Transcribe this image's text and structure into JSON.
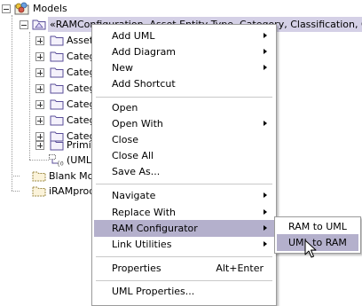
{
  "tree": {
    "root_label": "Models",
    "selected_label": "«RAMConfiguration, Asset Entity Type, Category, Classification, Custom",
    "children": [
      {
        "label": "Asset",
        "icon": "folder-icon"
      },
      {
        "label": "Categ",
        "icon": "folder-icon"
      },
      {
        "label": "Categ",
        "icon": "folder-icon"
      },
      {
        "label": "Categ",
        "icon": "folder-icon"
      },
      {
        "label": "Categ",
        "icon": "folder-icon"
      },
      {
        "label": "Categ",
        "icon": "folder-icon"
      },
      {
        "label": "Categ",
        "icon": "folder-icon"
      },
      {
        "label": "Primit",
        "icon": "folder-icon"
      },
      {
        "label": "(UMLP",
        "icon": "uml-link-icon"
      }
    ],
    "siblings": [
      {
        "label": "Blank Mod",
        "icon": "model-icon"
      },
      {
        "label": "iRAMprod",
        "icon": "model-icon"
      }
    ]
  },
  "context_menu": {
    "items": {
      "add_uml": "Add UML",
      "add_diagram": "Add Diagram",
      "new": "New",
      "add_shortcut": "Add Shortcut",
      "open": "Open",
      "open_with": "Open With",
      "close": "Close",
      "close_all": "Close All",
      "save_as": "Save As...",
      "navigate": "Navigate",
      "replace_with": "Replace With",
      "ram_configurator": "RAM Configurator",
      "link_utilities": "Link Utilities",
      "properties": "Properties",
      "properties_accel": "Alt+Enter",
      "uml_properties": "UML Properties..."
    },
    "active_item": "RAM Configurator"
  },
  "submenu": {
    "items": {
      "ram_to_uml": "RAM to UML",
      "uml_to_ram": "UML to RAM"
    },
    "active_item": "UML to RAM"
  },
  "colors": {
    "menu_highlight": "#b4b0cc",
    "tree_selection": "#d4d0e6",
    "folder_fill": "#f4f1fb",
    "folder_stroke": "#5a4e9a"
  }
}
